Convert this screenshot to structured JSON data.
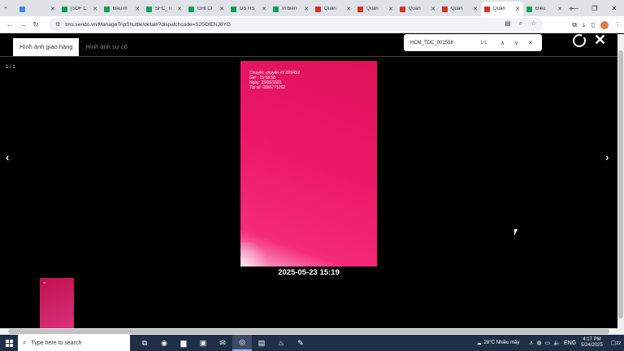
{
  "browser": {
    "tabs": [
      {
        "label": "",
        "favicon_color": "#4285f4",
        "active": false
      },
      {
        "label": "[SDF C",
        "favicon_color": "#0f9d58",
        "active": false
      },
      {
        "label": "Đầu m",
        "favicon_color": "#0f9d58",
        "active": false
      },
      {
        "label": "SFC_Ti",
        "favicon_color": "#0f9d58",
        "active": false
      },
      {
        "label": "GHI CI",
        "favicon_color": "#0f9d58",
        "active": false
      },
      {
        "label": "DS HS",
        "favicon_color": "#0f9d58",
        "active": false
      },
      {
        "label": "In biên",
        "favicon_color": "#0f9d58",
        "active": false
      },
      {
        "label": "Quản",
        "favicon_color": "#d93025",
        "active": false
      },
      {
        "label": "Quản",
        "favicon_color": "#d93025",
        "active": false
      },
      {
        "label": "Quản",
        "favicon_color": "#d93025",
        "active": false
      },
      {
        "label": "Quản",
        "favicon_color": "#d93025",
        "active": false
      },
      {
        "label": "Quản",
        "favicon_color": "#d93025",
        "active": true
      },
      {
        "label": "Điều",
        "favicon_color": "#0f9d58",
        "active": false
      }
    ],
    "url": "tms.sendo.vn/ManageTripShuttle/detail/?dispatchcode=S25OIENJ8YG",
    "find": {
      "query": "HCM_TDC_001558",
      "count": "1/1"
    }
  },
  "viewer": {
    "tab_delivery": "Hình ảnh giao hàng",
    "tab_incident": "Hình ảnh sự cố",
    "counter": "1 / 1",
    "prev_glyph": "‹",
    "next_glyph": "›",
    "close_glyph": "✕",
    "timestamp": "2025-05-23 15:19",
    "watermark_lines": [
      "Chuyến: chuyến 4Y 8294S2",
      "Giờ : 15:18:58",
      "Ngày: 23/05/2025",
      "Tài xế: 0366771202"
    ]
  },
  "taskbar": {
    "search_placeholder": "Type here to search",
    "weather": "28°C Nhiều mây",
    "time": "4:17 PM",
    "date": "5/24/2025",
    "notification_count": "22"
  }
}
